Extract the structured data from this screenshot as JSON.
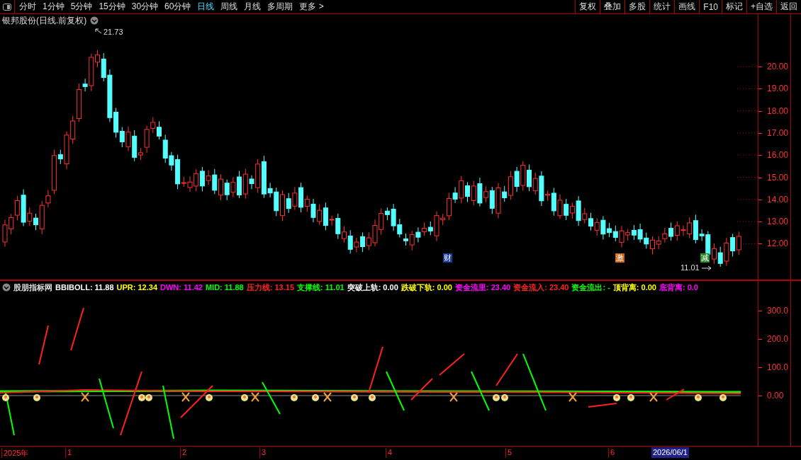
{
  "toolbar": {
    "periods": [
      {
        "label": "分时",
        "selected": false
      },
      {
        "label": "1分钟",
        "selected": false
      },
      {
        "label": "5分钟",
        "selected": false
      },
      {
        "label": "15分钟",
        "selected": false
      },
      {
        "label": "30分钟",
        "selected": false
      },
      {
        "label": "60分钟",
        "selected": false
      },
      {
        "label": "日线",
        "selected": true
      },
      {
        "label": "周线",
        "selected": false
      },
      {
        "label": "月线",
        "selected": false
      },
      {
        "label": "多周期",
        "selected": false
      },
      {
        "label": "更多 >",
        "selected": false
      }
    ],
    "actions": [
      "复权",
      "叠加",
      "多股",
      "统计",
      "画线",
      "F10",
      "标记",
      "+自选",
      "返回"
    ]
  },
  "chart": {
    "title": "银邦股份(日线.前复权)",
    "price_labels": [
      "20.00",
      "19.00",
      "18.00",
      "17.00",
      "16.00",
      "15.00",
      "14.00",
      "13.00",
      "12.00"
    ],
    "high_label": "21.73",
    "low_label": "11.01",
    "markers": [
      {
        "text": "财",
        "color": "#1a3a9a"
      },
      {
        "text": "激",
        "color": "#c86414"
      },
      {
        "text": "减",
        "color": "#2a8a2a"
      }
    ]
  },
  "indicator": {
    "name": "股朋指标网",
    "readouts": [
      {
        "text": "BBIBOLL: 11.88",
        "color": "#ffffff"
      },
      {
        "text": "UPR: 12.34",
        "color": "#ffff00"
      },
      {
        "text": "DWN: 11.42",
        "color": "#ff00ff"
      },
      {
        "text": "MID: 11.88",
        "color": "#00ff00"
      },
      {
        "text": "压力线: 13.15",
        "color": "#ff2020"
      },
      {
        "text": "支撑线: 11.01",
        "color": "#00ff00"
      },
      {
        "text": "突破上轨: 0.00",
        "color": "#ffffff"
      },
      {
        "text": "跌破下轨: 0.00",
        "color": "#ffff00"
      },
      {
        "text": "资金流里: 23.40",
        "color": "#ff00ff"
      },
      {
        "text": "资金流入: 23.40",
        "color": "#ff2020"
      },
      {
        "text": "资金流出: -",
        "color": "#00ff00"
      },
      {
        "text": "顶背离: 0.00",
        "color": "#ffff00"
      },
      {
        "text": "底背离: 0.0",
        "color": "#ff00ff"
      }
    ],
    "axis_labels": [
      "300.0",
      "200.0",
      "100.0",
      "0.00"
    ]
  },
  "time_axis": {
    "labels": [
      "2025年",
      "1",
      "2",
      "3",
      "4",
      "5",
      "6"
    ],
    "current_date": "2026/06/1"
  }
}
